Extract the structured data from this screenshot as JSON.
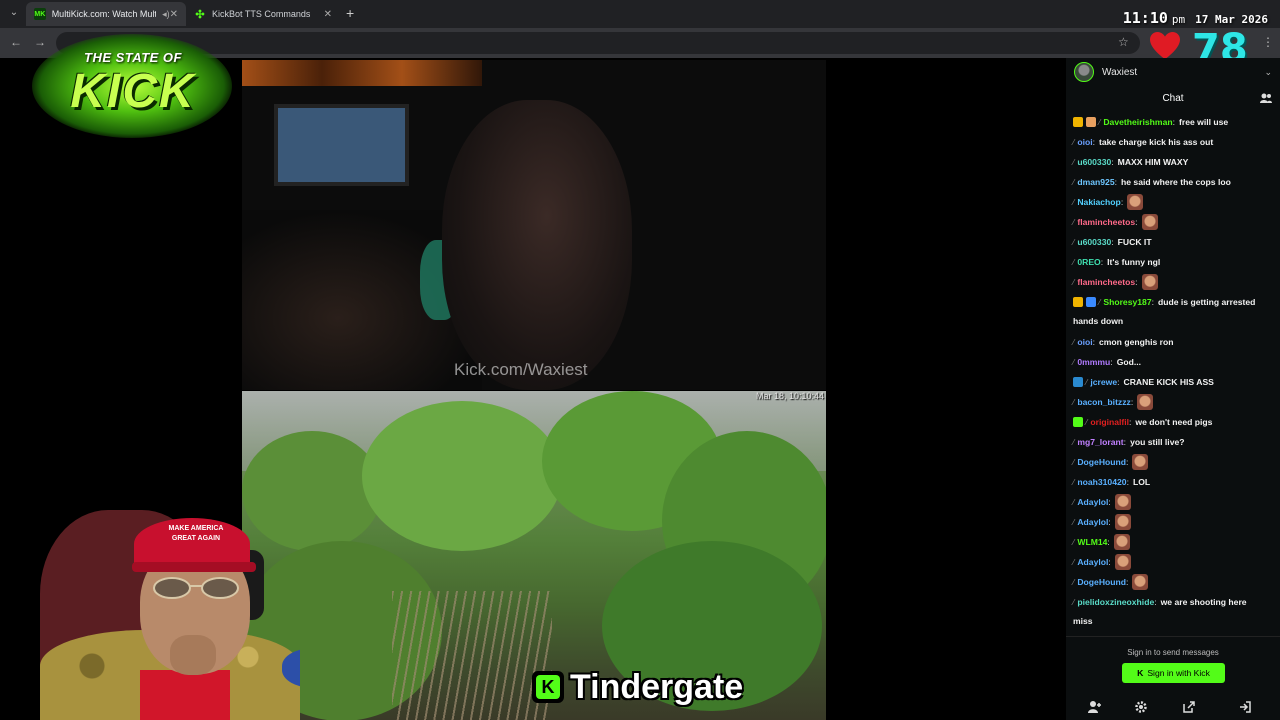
{
  "browser": {
    "tabs": [
      {
        "title": "MultiKick.com: Watch Multi",
        "favicon": "multikick-icon",
        "active": true
      },
      {
        "title": "KickBot TTS Commands",
        "favicon": "kickbot-icon",
        "active": false
      }
    ]
  },
  "overlay": {
    "clock": {
      "time": "11:10",
      "ampm": "pm",
      "date": "17 Mar 2026"
    },
    "counter": "78",
    "heart_color": "#e01b24",
    "logo": {
      "top": "THE STATE OF",
      "main": "KICK"
    },
    "lower_third": {
      "label": "Tindergate",
      "icon": "kick-k-icon"
    },
    "webcam_hat_text": "MAKE AMERICA\nGREAT AGAIN"
  },
  "streams": {
    "top": {
      "watermark": "Kick.com/Waxiest"
    },
    "bottom": {
      "timestamp": "Mar 18, 10:10:44"
    }
  },
  "chat": {
    "channel": "Waxiest",
    "title": "Chat",
    "messages": [
      {
        "user": "Davetheirishman",
        "color": "#53fc18",
        "text": "free will use",
        "badges": [
          "#f0b400",
          "#e8a060"
        ]
      },
      {
        "user": "oioi",
        "color": "#6aa0ff",
        "text": "take charge kick his ass out",
        "badges": []
      },
      {
        "user": "u600330",
        "color": "#5adbc8",
        "text": "MAXX HIM WAXY",
        "badges": []
      },
      {
        "user": "dman925",
        "color": "#6ec6ff",
        "text": "he said where the cops loo",
        "badges": []
      },
      {
        "user": "Nakiachop",
        "color": "#53d1ff",
        "text": "",
        "badges": [],
        "emote": true
      },
      {
        "user": "flamincheetos",
        "color": "#ff6a8a",
        "text": "",
        "badges": [],
        "emote": true
      },
      {
        "user": "u600330",
        "color": "#5adbc8",
        "text": "FUCK IT",
        "badges": []
      },
      {
        "user": "0REO",
        "color": "#3fe0b0",
        "text": "It's funny ngl",
        "badges": []
      },
      {
        "user": "flamincheetos",
        "color": "#ff6a8a",
        "text": "",
        "badges": [],
        "emote": true
      },
      {
        "user": "Shoresy187",
        "color": "#53fc18",
        "text": "dude is getting arrested",
        "badges": [
          "#f0b400",
          "#3a8aff"
        ]
      },
      {
        "user": "oioi",
        "color": "#6aa0ff",
        "text": "cmon genghis ron",
        "badges": []
      },
      {
        "user": "0mmmu",
        "color": "#b07aff",
        "text": "God...",
        "badges": []
      },
      {
        "user": "jcrewe",
        "color": "#5ab0ff",
        "text": "CRANE KICK HIS ASS",
        "badges": [
          "#2a8ad0"
        ]
      },
      {
        "user": "bacon_bitzzz",
        "color": "#5ab0ff",
        "text": "",
        "badges": [],
        "emote": true
      },
      {
        "user": "originalfil",
        "color": "#e02020",
        "text": "we don't need pigs",
        "badges": [
          "#53fc18"
        ]
      },
      {
        "user": "mg7_lorant",
        "color": "#c080ff",
        "text": "you still live?",
        "badges": []
      },
      {
        "user": "DogeHound",
        "color": "#5ab0ff",
        "text": "",
        "badges": [],
        "emote": true
      },
      {
        "user": "noah310420",
        "color": "#5ab0ff",
        "text": "LOL",
        "badges": []
      },
      {
        "user": "Adaylol",
        "color": "#5ab0ff",
        "text": "",
        "badges": [],
        "emote": true
      },
      {
        "user": "Adaylol",
        "color": "#5ab0ff",
        "text": "",
        "badges": [],
        "emote": true
      },
      {
        "user": "WLM14",
        "color": "#53fc18",
        "text": "",
        "badges": [],
        "emote": true
      },
      {
        "user": "Adaylol",
        "color": "#5ab0ff",
        "text": "",
        "badges": [],
        "emote": true
      },
      {
        "user": "DogeHound",
        "color": "#5ab0ff",
        "text": "",
        "badges": [],
        "emote": true
      },
      {
        "user": "pielidoxzineoxhide",
        "color": "#5adbc8",
        "text": "we are shooting here",
        "badges": []
      }
    ],
    "continuations": {
      "shoresy": "hands down",
      "pielido": "miss"
    },
    "signin_hint": "Sign in to send messages",
    "signin_button": "Sign in with Kick",
    "accent": "#53fc18"
  }
}
